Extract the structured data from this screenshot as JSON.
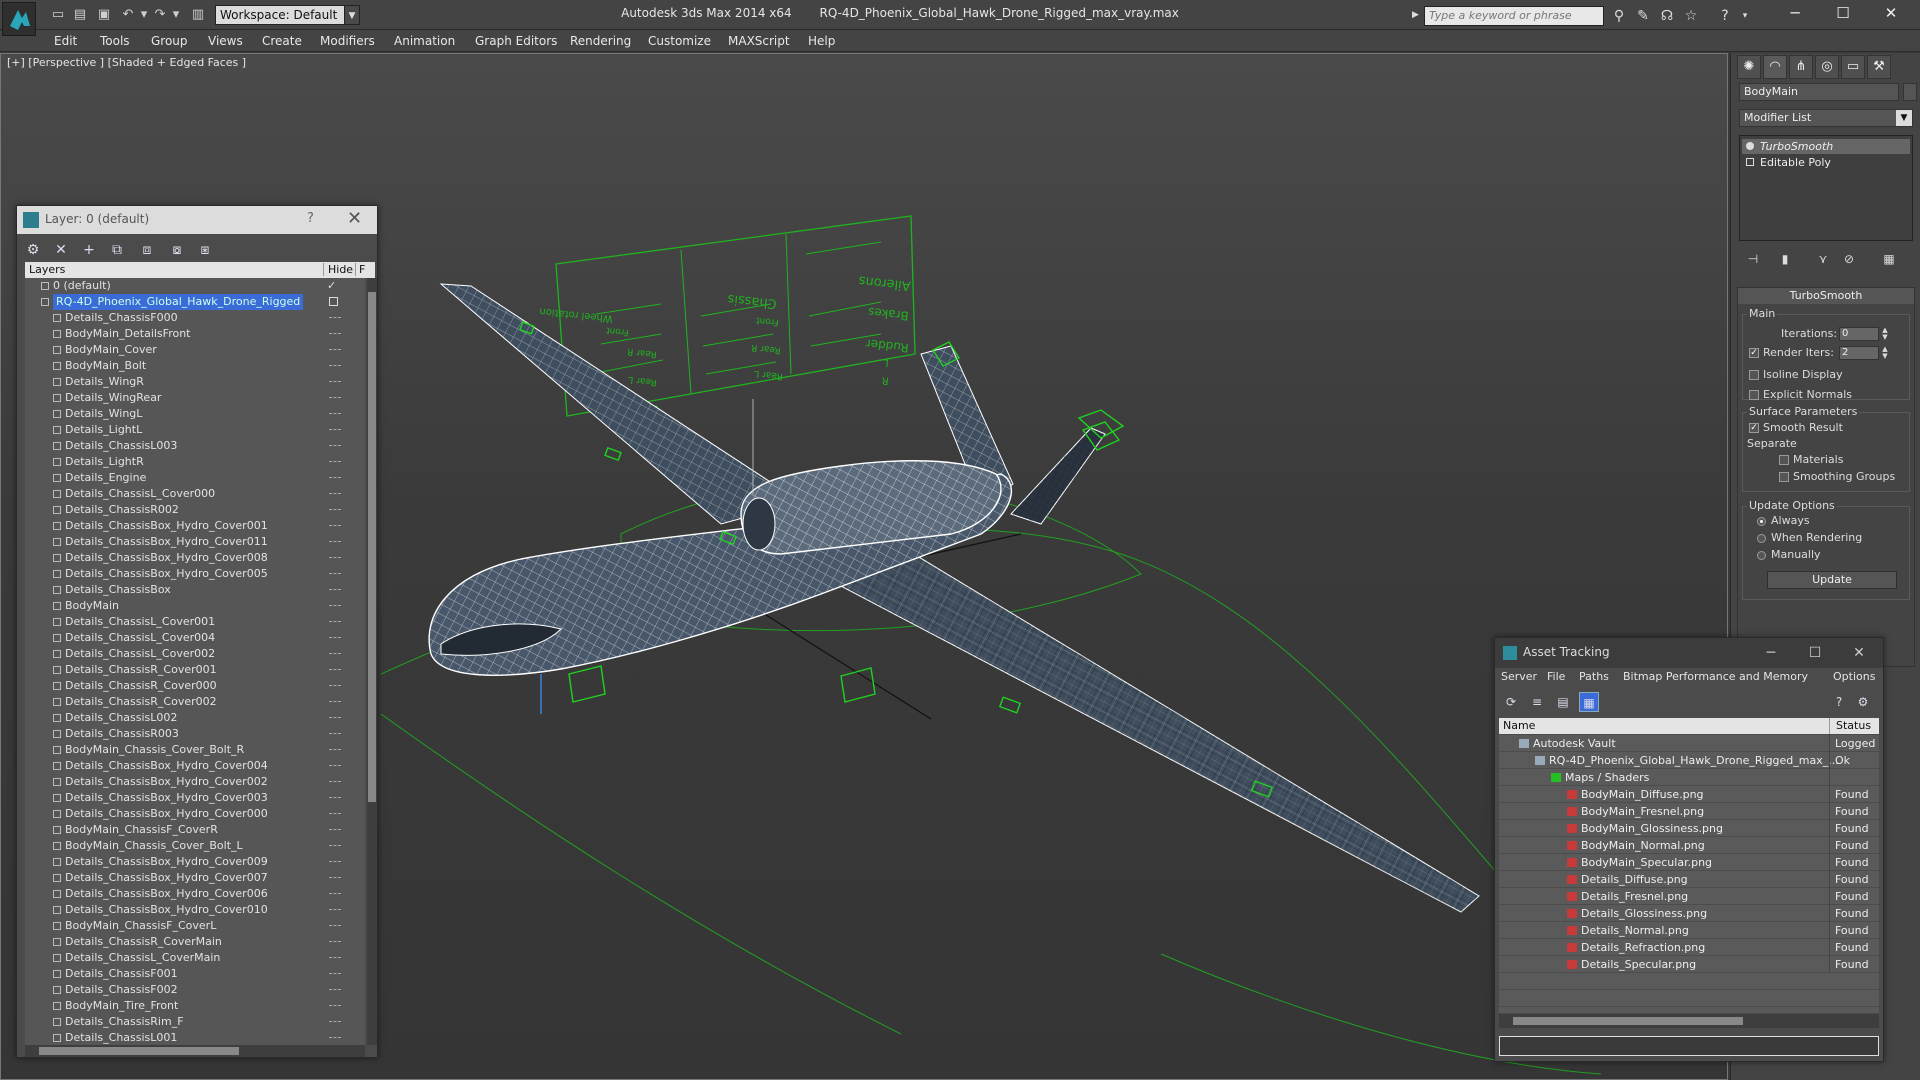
{
  "titlebar": {
    "workspace": "Workspace: Default",
    "app_name": "Autodesk 3ds Max 2014 x64",
    "file_name": "RQ-4D_Phoenix_Global_Hawk_Drone_Rigged_max_vray.max",
    "search_placeholder": "Type a keyword or phrase"
  },
  "menu": [
    "Edit",
    "Tools",
    "Group",
    "Views",
    "Create",
    "Modifiers",
    "Animation",
    "Graph Editors",
    "Rendering",
    "Customize",
    "MAXScript",
    "Help"
  ],
  "viewport": {
    "label": "[+] [Perspective ] [Shaded + Edged Faces ]",
    "control_labels": [
      "Wheel rotation",
      "Front",
      "Rear R",
      "Rear L",
      "Engine",
      "Chassis",
      "Front",
      "Rear R",
      "Rear L",
      "Ailerons",
      "Brakes",
      "Rudder",
      "L",
      "R"
    ]
  },
  "layer_panel": {
    "title": "Layer: 0 (default)",
    "help": "?",
    "col_layers": "Layers",
    "col_hide": "Hide",
    "col_extra": "F",
    "layers": [
      {
        "name": "0 (default)",
        "level": 0,
        "checked": true
      },
      {
        "name": "RQ-4D_Phoenix_Global_Hawk_Drone_Rigged",
        "level": 0,
        "selected": true
      },
      {
        "name": "Details_ChassisF000",
        "level": 1
      },
      {
        "name": "BodyMain_DetailsFront",
        "level": 1
      },
      {
        "name": "BodyMain_Cover",
        "level": 1
      },
      {
        "name": "BodyMain_Bolt",
        "level": 1
      },
      {
        "name": "Details_WingR",
        "level": 1
      },
      {
        "name": "Details_WingRear",
        "level": 1
      },
      {
        "name": "Details_WingL",
        "level": 1
      },
      {
        "name": "Details_LightL",
        "level": 1
      },
      {
        "name": "Details_ChassisL003",
        "level": 1
      },
      {
        "name": "Details_LightR",
        "level": 1
      },
      {
        "name": "Details_Engine",
        "level": 1
      },
      {
        "name": "Details_ChassisL_Cover000",
        "level": 1
      },
      {
        "name": "Details_ChassisR002",
        "level": 1
      },
      {
        "name": "Details_ChassisBox_Hydro_Cover001",
        "level": 1
      },
      {
        "name": "Details_ChassisBox_Hydro_Cover011",
        "level": 1
      },
      {
        "name": "Details_ChassisBox_Hydro_Cover008",
        "level": 1
      },
      {
        "name": "Details_ChassisBox_Hydro_Cover005",
        "level": 1
      },
      {
        "name": "Details_ChassisBox",
        "level": 1
      },
      {
        "name": "BodyMain",
        "level": 1
      },
      {
        "name": "Details_ChassisL_Cover001",
        "level": 1
      },
      {
        "name": "Details_ChassisL_Cover004",
        "level": 1
      },
      {
        "name": "Details_ChassisL_Cover002",
        "level": 1
      },
      {
        "name": "Details_ChassisR_Cover001",
        "level": 1
      },
      {
        "name": "Details_ChassisR_Cover000",
        "level": 1
      },
      {
        "name": "Details_ChassisR_Cover002",
        "level": 1
      },
      {
        "name": "Details_ChassisL002",
        "level": 1
      },
      {
        "name": "Details_ChassisR003",
        "level": 1
      },
      {
        "name": "BodyMain_Chassis_Cover_Bolt_R",
        "level": 1
      },
      {
        "name": "Details_ChassisBox_Hydro_Cover004",
        "level": 1
      },
      {
        "name": "Details_ChassisBox_Hydro_Cover002",
        "level": 1
      },
      {
        "name": "Details_ChassisBox_Hydro_Cover003",
        "level": 1
      },
      {
        "name": "Details_ChassisBox_Hydro_Cover000",
        "level": 1
      },
      {
        "name": "BodyMain_ChassisF_CoverR",
        "level": 1
      },
      {
        "name": "BodyMain_Chassis_Cover_Bolt_L",
        "level": 1
      },
      {
        "name": "Details_ChassisBox_Hydro_Cover009",
        "level": 1
      },
      {
        "name": "Details_ChassisBox_Hydro_Cover007",
        "level": 1
      },
      {
        "name": "Details_ChassisBox_Hydro_Cover006",
        "level": 1
      },
      {
        "name": "Details_ChassisBox_Hydro_Cover010",
        "level": 1
      },
      {
        "name": "BodyMain_ChassisF_CoverL",
        "level": 1
      },
      {
        "name": "Details_ChassisR_CoverMain",
        "level": 1
      },
      {
        "name": "Details_ChassisL_CoverMain",
        "level": 1
      },
      {
        "name": "Details_ChassisF001",
        "level": 1
      },
      {
        "name": "Details_ChassisF002",
        "level": 1
      },
      {
        "name": "BodyMain_Tire_Front",
        "level": 1
      },
      {
        "name": "Details_ChassisRim_F",
        "level": 1
      },
      {
        "name": "Details_ChassisL001",
        "level": 1
      }
    ]
  },
  "command_panel": {
    "object_name": "BodyMain",
    "modifier_list": "Modifier List",
    "stack": [
      "TurboSmooth",
      "Editable Poly"
    ],
    "turbosmooth": {
      "header": "TurboSmooth",
      "main_label": "Main",
      "iterations_label": "Iterations:",
      "iterations_value": "0",
      "render_iters_label": "Render Iters:",
      "render_iters_value": "2",
      "isoline": "Isoline Display",
      "explicit_normals": "Explicit Normals",
      "surface_params": "Surface Parameters",
      "smooth_result": "Smooth Result",
      "separate": "Separate",
      "materials": "Materials",
      "smoothing_groups": "Smoothing Groups",
      "update_options": "Update Options",
      "always": "Always",
      "when_rendering": "When Rendering",
      "manually": "Manually",
      "update_button": "Update"
    }
  },
  "asset_tracking": {
    "title": "Asset Tracking",
    "menu": [
      "Server",
      "File",
      "Paths",
      "Bitmap Performance and Memory",
      "Options"
    ],
    "col_name": "Name",
    "col_status": "Status",
    "rows": [
      {
        "name": "Autodesk Vault",
        "status": "Logged",
        "level": 0,
        "kind": "vault"
      },
      {
        "name": "RQ-4D_Phoenix_Global_Hawk_Drone_Rigged_max_...",
        "status": "Ok",
        "level": 1,
        "kind": "file"
      },
      {
        "name": "Maps / Shaders",
        "status": "",
        "level": 2,
        "kind": "folder"
      },
      {
        "name": "BodyMain_Diffuse.png",
        "status": "Found",
        "level": 3,
        "kind": "png"
      },
      {
        "name": "BodyMain_Fresnel.png",
        "status": "Found",
        "level": 3,
        "kind": "png"
      },
      {
        "name": "BodyMain_Glossiness.png",
        "status": "Found",
        "level": 3,
        "kind": "png"
      },
      {
        "name": "BodyMain_Normal.png",
        "status": "Found",
        "level": 3,
        "kind": "png"
      },
      {
        "name": "BodyMain_Specular.png",
        "status": "Found",
        "level": 3,
        "kind": "png"
      },
      {
        "name": "Details_Diffuse.png",
        "status": "Found",
        "level": 3,
        "kind": "png"
      },
      {
        "name": "Details_Fresnel.png",
        "status": "Found",
        "level": 3,
        "kind": "png"
      },
      {
        "name": "Details_Glossiness.png",
        "status": "Found",
        "level": 3,
        "kind": "png"
      },
      {
        "name": "Details_Normal.png",
        "status": "Found",
        "level": 3,
        "kind": "png"
      },
      {
        "name": "Details_Refraction.png",
        "status": "Found",
        "level": 3,
        "kind": "png"
      },
      {
        "name": "Details_Specular.png",
        "status": "Found",
        "level": 3,
        "kind": "png"
      }
    ]
  },
  "colors": {
    "selection": "#3b6bd6",
    "helper_green": "#22c022",
    "png_red": "#c83a3a"
  }
}
